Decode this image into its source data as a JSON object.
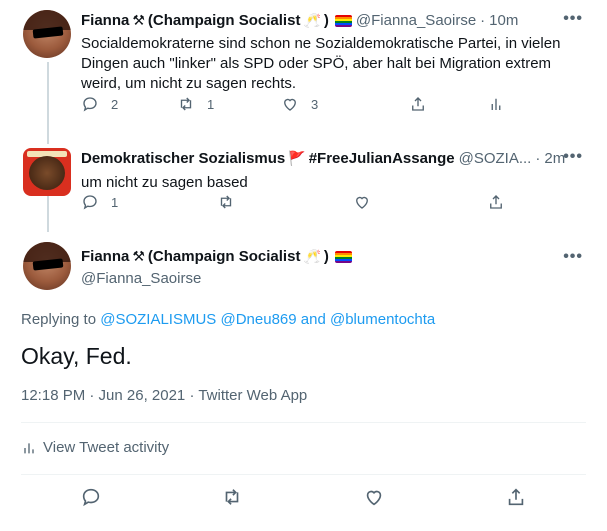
{
  "tweet1": {
    "name": "Fianna",
    "name_suffix": "(Champaign Socialist",
    "name_close": ")",
    "handle": "@Fianna_Saoirse",
    "time": "10m",
    "more": "•••",
    "text": "Socialdemokraterne sind schon ne Sozialdemokratische Partei, in vielen Dingen auch \"linker\" als SPD oder SPÖ, aber halt bei Migration extrem weird, um nicht zu sagen rechts.",
    "reply_count": "2",
    "retweet_count": "1",
    "like_count": "3"
  },
  "tweet2": {
    "name": "Demokratischer Sozialismus",
    "hashtag": "#FreeJulianAssange",
    "handle": "@SOZIA...",
    "time": "2m",
    "more": "•••",
    "text": "um nicht zu sagen based",
    "reply_count": "1"
  },
  "main": {
    "name": "Fianna",
    "name_suffix": "(Champaign Socialist",
    "name_close": ")",
    "handle": "@Fianna_Saoirse",
    "more": "•••",
    "replying_prefix": "Replying to",
    "mention1": "@SOZIALISMUS",
    "mention2": "@Dneu869",
    "and_word": "and",
    "mention3": "@blumentochta",
    "text": "Okay, Fed.",
    "timestamp": "12:18 PM · Jun 26, 2021 · Twitter Web App",
    "activity_label": "View Tweet activity"
  },
  "colors": {
    "accent": "#1d9bf0",
    "secondary_text": "#536471",
    "divider": "#eff3f4"
  }
}
